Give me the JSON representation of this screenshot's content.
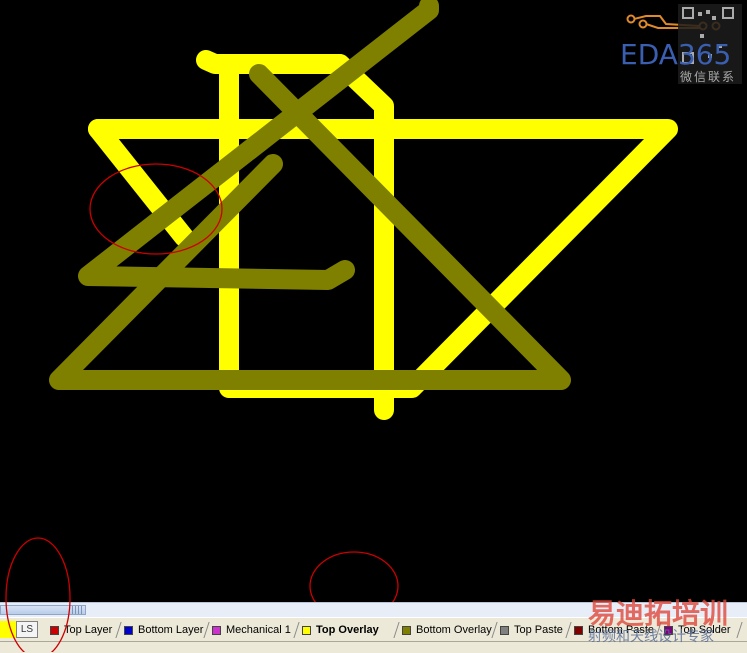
{
  "watermark": {
    "brand": "EDA365",
    "caption": "微信联系",
    "footer_title": "易迪拓培训",
    "footer_subtitle": "射频和天线设计专家"
  },
  "layer_bar": {
    "current_label": "LS",
    "tabs": [
      {
        "label": "Top Layer",
        "color": "#cc0000",
        "active": false
      },
      {
        "label": "Bottom Layer",
        "color": "#0000cc",
        "active": false
      },
      {
        "label": "Mechanical 1",
        "color": "#cc33cc",
        "active": false
      },
      {
        "label": "Top Overlay",
        "color": "#ffff00",
        "active": true
      },
      {
        "label": "Bottom Overlay",
        "color": "#808000",
        "active": false
      },
      {
        "label": "Top Paste",
        "color": "#808080",
        "active": false
      },
      {
        "label": "Bottom Paste",
        "color": "#800000",
        "active": false
      },
      {
        "label": "Top Solder",
        "color": "#800080",
        "active": false
      }
    ]
  },
  "colors": {
    "top_overlay": "#ffff00",
    "bottom_overlay": "#808000",
    "annotation": "#cc0000",
    "background": "#000000"
  }
}
